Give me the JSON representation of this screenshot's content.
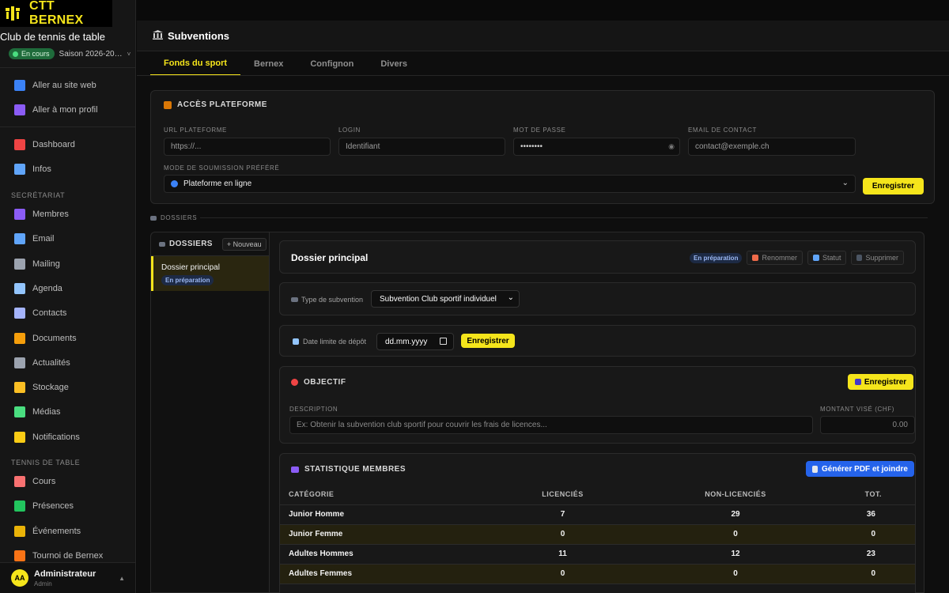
{
  "brand": {
    "name": "CTT BERNEX",
    "club": "Club de tennis de table"
  },
  "season": {
    "status": "En cours",
    "label": "Saison 2026-20…"
  },
  "sidebar": {
    "top_links": [
      {
        "label": "Aller au site web",
        "icon": "globe-icon",
        "color": "#3b82f6"
      },
      {
        "label": "Aller à mon profil",
        "icon": "user-icon",
        "color": "#8b5cf6"
      }
    ],
    "main_links": [
      {
        "label": "Dashboard",
        "icon": "chart-icon",
        "color": "#ef4444"
      },
      {
        "label": "Infos",
        "icon": "building-icon",
        "color": "#60a5fa"
      }
    ],
    "section_secretariat": "SECRÉTARIAT",
    "secretariat_links": [
      {
        "label": "Membres",
        "icon": "users-icon",
        "color": "#8b5cf6"
      },
      {
        "label": "Email",
        "icon": "email-icon",
        "color": "#60a5fa"
      },
      {
        "label": "Mailing",
        "icon": "mailing-icon",
        "color": "#9ca3af"
      },
      {
        "label": "Agenda",
        "icon": "calendar-icon",
        "color": "#93c5fd"
      },
      {
        "label": "Contacts",
        "icon": "contacts-icon",
        "color": "#a5b4fc"
      },
      {
        "label": "Documents",
        "icon": "folder-icon",
        "color": "#f59e0b"
      },
      {
        "label": "Actualités",
        "icon": "news-icon",
        "color": "#9ca3af"
      },
      {
        "label": "Stockage",
        "icon": "storage-icon",
        "color": "#fbbf24"
      },
      {
        "label": "Médias",
        "icon": "image-icon",
        "color": "#4ade80"
      },
      {
        "label": "Notifications",
        "icon": "bell-icon",
        "color": "#facc15"
      }
    ],
    "section_tennis": "TENNIS DE TABLE",
    "tennis_links": [
      {
        "label": "Cours",
        "icon": "clipboard-icon",
        "color": "#f87171"
      },
      {
        "label": "Présences",
        "icon": "check-icon",
        "color": "#22c55e"
      },
      {
        "label": "Événements",
        "icon": "trophy-icon",
        "color": "#eab308"
      },
      {
        "label": "Tournoi de Bernex",
        "icon": "medal-icon",
        "color": "#f97316"
      }
    ],
    "user": {
      "initials": "AA",
      "name": "Administrateur",
      "role": "Admin"
    }
  },
  "page": {
    "title": "Subventions",
    "tabs": [
      "Fonds du sport",
      "Bernex",
      "Confignon",
      "Divers"
    ]
  },
  "platform": {
    "title": "ACCÈS PLATEFORME",
    "url_label": "URL PLATEFORME",
    "url_placeholder": "https://...",
    "login_label": "LOGIN",
    "login_placeholder": "Identifiant",
    "password_label": "MOT DE PASSE",
    "password_value": "••••••••",
    "email_label": "EMAIL DE CONTACT",
    "email_placeholder": "contact@exemple.ch",
    "mode_label": "MODE DE SOUMISSION PRÉFÉRÉ",
    "mode_value": "Plateforme en ligne",
    "save_label": "Enregistrer"
  },
  "dossiers": {
    "section_label": "DOSSIERS",
    "panel_title": "DOSSIERS",
    "new_label": "+ Nouveau",
    "items": [
      {
        "title": "Dossier principal",
        "status": "En préparation"
      }
    ]
  },
  "dossier": {
    "title": "Dossier principal",
    "status": "En préparation",
    "rename_label": "Renommer",
    "status_label": "Statut",
    "delete_label": "Supprimer",
    "type_label": "Type de subvention",
    "type_value": "Subvention Club sportif individuel",
    "deadline_label": "Date limite de dépôt",
    "deadline_placeholder": "dd.mm.yyyy",
    "deadline_save": "Enregistrer",
    "objective": {
      "title": "OBJECTIF",
      "save_label": "Enregistrer",
      "desc_label": "DESCRIPTION",
      "desc_placeholder": "Ex: Obtenir la subvention club sportif pour couvrir les frais de licences...",
      "amount_label": "MONTANT VISÉ (CHF)",
      "amount_placeholder": "0.00"
    },
    "stats": {
      "title": "STATISTIQUE MEMBRES",
      "pdf_label": "Générer PDF et joindre",
      "headers": [
        "CATÉGORIE",
        "LICENCIÉS",
        "NON-LICENCIÉS",
        "TOT."
      ],
      "rows": [
        {
          "category": "Junior Homme",
          "licensed": "7",
          "unlicensed": "29",
          "total": "36"
        },
        {
          "category": "Junior Femme",
          "licensed": "0",
          "unlicensed": "0",
          "total": "0"
        },
        {
          "category": "Adultes Hommes",
          "licensed": "11",
          "unlicensed": "12",
          "total": "23"
        },
        {
          "category": "Adultes Femmes",
          "licensed": "0",
          "unlicensed": "0",
          "total": "0"
        }
      ]
    }
  }
}
